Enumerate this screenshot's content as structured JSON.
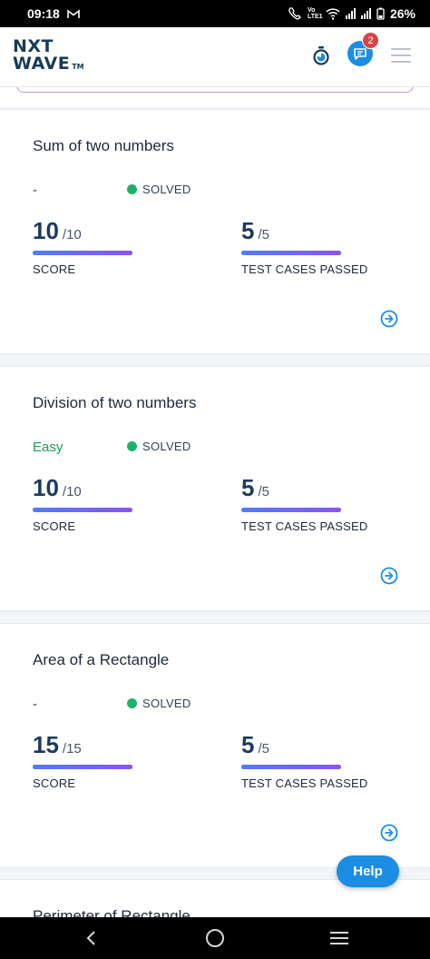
{
  "status_bar": {
    "time": "09:18",
    "mail_icon": "gmail-icon",
    "battery": "26%",
    "network_label": "Vo LTE1"
  },
  "header": {
    "logo_line1": "NXT",
    "logo_line2": "WAVE",
    "logo_tm": "TM",
    "timer_icon": "stopwatch-icon",
    "chat_icon": "chat-bubble-icon",
    "notification_count": "2",
    "menu_icon": "hamburger-menu-icon",
    "brand_color": "#183b56",
    "accent_color": "#1b8de3"
  },
  "cards": [
    {
      "title": "Sum of two numbers",
      "difficulty": "-",
      "status": "SOLVED",
      "score": "10",
      "score_max": "/10",
      "score_label": "SCORE",
      "score_fraction": 1.0,
      "tests": "5",
      "tests_max": "/5",
      "tests_label": "TEST CASES PASSED",
      "tests_fraction": 1.0
    },
    {
      "title": "Division of two numbers",
      "difficulty": "Easy",
      "status": "SOLVED",
      "score": "10",
      "score_max": "/10",
      "score_label": "SCORE",
      "score_fraction": 1.0,
      "tests": "5",
      "tests_max": "/5",
      "tests_label": "TEST CASES PASSED",
      "tests_fraction": 1.0
    },
    {
      "title": "Area of a Rectangle",
      "difficulty": "-",
      "status": "SOLVED",
      "score": "15",
      "score_max": "/15",
      "score_label": "SCORE",
      "score_fraction": 1.0,
      "tests": "5",
      "tests_max": "/5",
      "tests_label": "TEST CASES PASSED",
      "tests_fraction": 1.0
    },
    {
      "title": "Perimeter of Rectangle"
    }
  ],
  "help_button": {
    "label": "Help"
  },
  "colors": {
    "solved_dot": "#1bb36a",
    "easy": "#1c9b54",
    "progress_start": "#4f7ef2",
    "progress_end": "#8a55ee"
  }
}
